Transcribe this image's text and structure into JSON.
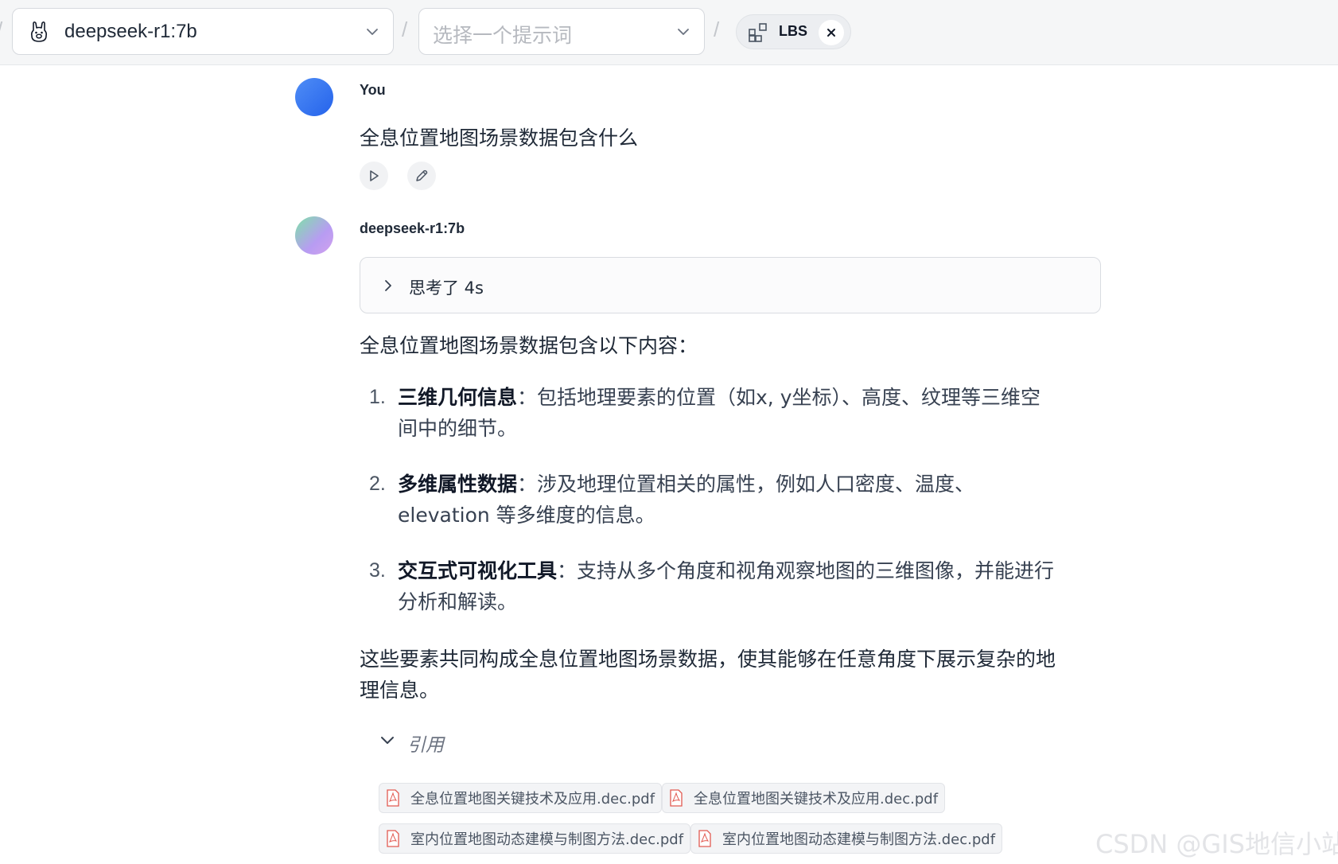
{
  "header": {
    "model_select": {
      "value": "deepseek-r1:7b",
      "icon": "llama-icon"
    },
    "prompt_select": {
      "placeholder": "选择一个提示词"
    },
    "separator": "/",
    "knowledge_base_chip": {
      "label": "LBS",
      "icon": "apps-grid-icon"
    }
  },
  "messages": {
    "user": {
      "sender": "You",
      "text": "全息位置地图场景数据包含什么"
    },
    "assistant": {
      "sender": "deepseek-r1:7b",
      "thinking_label": "思考了 4s",
      "intro": "全息位置地图场景数据包含以下内容：",
      "items": [
        {
          "num": "1.",
          "title": "三维几何信息",
          "text": "：包括地理要素的位置（如x, y坐标）、高度、纹理等三维空间中的细节。"
        },
        {
          "num": "2.",
          "title": "多维属性数据",
          "text": "：涉及地理位置相关的属性，例如人口密度、温度、 elevation 等多维度的信息。"
        },
        {
          "num": "3.",
          "title": "交互式可视化工具",
          "text": "：支持从多个角度和视角观察地图的三维图像，并能进行分析和解读。"
        }
      ],
      "summary": "这些要素共同构成全息位置地图场景数据，使其能够在任意角度下展示复杂的地理信息。",
      "citations_label": "引用",
      "citations": [
        "全息位置地图关键技术及应用.dec.pdf",
        "全息位置地图关键技术及应用.dec.pdf",
        "室内位置地图动态建模与制图方法.dec.pdf",
        "室内位置地图动态建模与制图方法.dec.pdf"
      ]
    }
  },
  "watermark": "CSDN @GIS地信小站",
  "colors": {
    "user_avatar": "#3b7cf0",
    "assistant_avatar_from": "#7ee2a8",
    "assistant_avatar_to": "#d2a2ee",
    "pdf_icon": "#e25a52"
  }
}
